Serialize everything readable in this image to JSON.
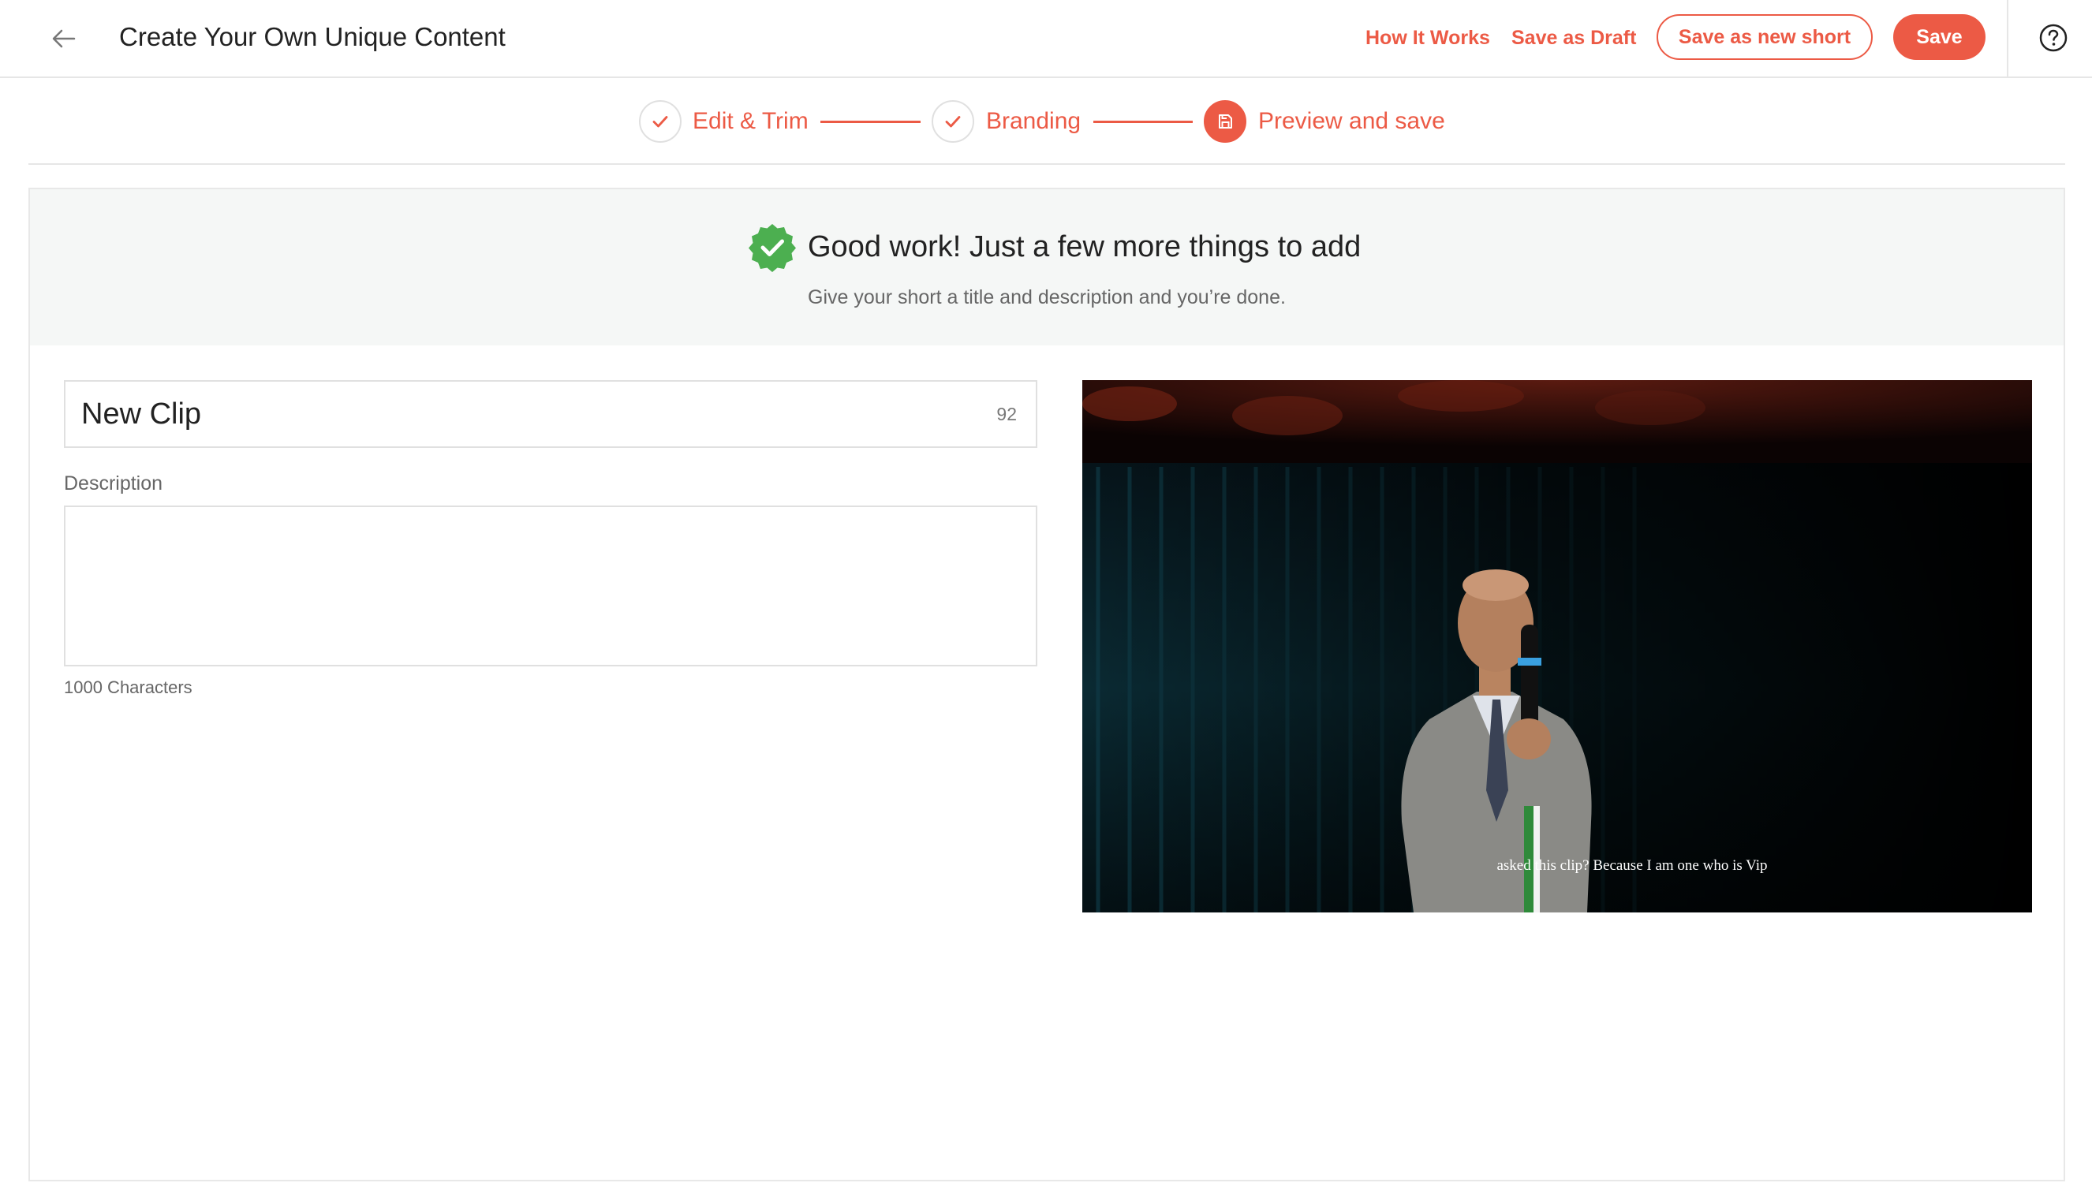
{
  "header": {
    "back_icon": "arrow-left-icon",
    "title": "Create Your Own Unique Content",
    "how_it_works": "How It Works",
    "save_as_draft": "Save as Draft",
    "save_as_new_short": "Save as new short",
    "save": "Save",
    "help_icon": "question-circle-icon"
  },
  "stepper": {
    "steps": [
      {
        "label": "Edit & Trim",
        "state": "completed",
        "icon": "check-icon"
      },
      {
        "label": "Branding",
        "state": "completed",
        "icon": "check-icon"
      },
      {
        "label": "Preview and save",
        "state": "active",
        "icon": "save-icon"
      }
    ]
  },
  "banner": {
    "icon": "verified-badge-icon",
    "title": "Good work! Just a few more things to add",
    "subtitle": "Give your short a title and description and you’re done."
  },
  "form": {
    "title_value": "New Clip",
    "title_remaining": "92",
    "description_label": "Description",
    "description_value": "",
    "description_hint": "1000 Characters"
  },
  "video": {
    "subtitle": "asked this clip? Because I am one who is Vip"
  },
  "colors": {
    "accent": "#ec5a45",
    "success": "#4caf50",
    "banner_bg": "#f5f7f6"
  }
}
